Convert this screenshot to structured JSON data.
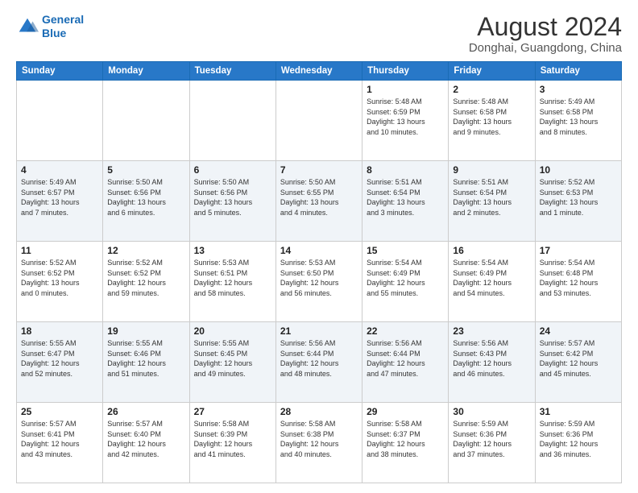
{
  "header": {
    "logo_line1": "General",
    "logo_line2": "Blue",
    "title": "August 2024",
    "subtitle": "Donghai, Guangdong, China"
  },
  "days_of_week": [
    "Sunday",
    "Monday",
    "Tuesday",
    "Wednesday",
    "Thursday",
    "Friday",
    "Saturday"
  ],
  "weeks": [
    [
      {
        "num": "",
        "info": ""
      },
      {
        "num": "",
        "info": ""
      },
      {
        "num": "",
        "info": ""
      },
      {
        "num": "",
        "info": ""
      },
      {
        "num": "1",
        "info": "Sunrise: 5:48 AM\nSunset: 6:59 PM\nDaylight: 13 hours\nand 10 minutes."
      },
      {
        "num": "2",
        "info": "Sunrise: 5:48 AM\nSunset: 6:58 PM\nDaylight: 13 hours\nand 9 minutes."
      },
      {
        "num": "3",
        "info": "Sunrise: 5:49 AM\nSunset: 6:58 PM\nDaylight: 13 hours\nand 8 minutes."
      }
    ],
    [
      {
        "num": "4",
        "info": "Sunrise: 5:49 AM\nSunset: 6:57 PM\nDaylight: 13 hours\nand 7 minutes."
      },
      {
        "num": "5",
        "info": "Sunrise: 5:50 AM\nSunset: 6:56 PM\nDaylight: 13 hours\nand 6 minutes."
      },
      {
        "num": "6",
        "info": "Sunrise: 5:50 AM\nSunset: 6:56 PM\nDaylight: 13 hours\nand 5 minutes."
      },
      {
        "num": "7",
        "info": "Sunrise: 5:50 AM\nSunset: 6:55 PM\nDaylight: 13 hours\nand 4 minutes."
      },
      {
        "num": "8",
        "info": "Sunrise: 5:51 AM\nSunset: 6:54 PM\nDaylight: 13 hours\nand 3 minutes."
      },
      {
        "num": "9",
        "info": "Sunrise: 5:51 AM\nSunset: 6:54 PM\nDaylight: 13 hours\nand 2 minutes."
      },
      {
        "num": "10",
        "info": "Sunrise: 5:52 AM\nSunset: 6:53 PM\nDaylight: 13 hours\nand 1 minute."
      }
    ],
    [
      {
        "num": "11",
        "info": "Sunrise: 5:52 AM\nSunset: 6:52 PM\nDaylight: 13 hours\nand 0 minutes."
      },
      {
        "num": "12",
        "info": "Sunrise: 5:52 AM\nSunset: 6:52 PM\nDaylight: 12 hours\nand 59 minutes."
      },
      {
        "num": "13",
        "info": "Sunrise: 5:53 AM\nSunset: 6:51 PM\nDaylight: 12 hours\nand 58 minutes."
      },
      {
        "num": "14",
        "info": "Sunrise: 5:53 AM\nSunset: 6:50 PM\nDaylight: 12 hours\nand 56 minutes."
      },
      {
        "num": "15",
        "info": "Sunrise: 5:54 AM\nSunset: 6:49 PM\nDaylight: 12 hours\nand 55 minutes."
      },
      {
        "num": "16",
        "info": "Sunrise: 5:54 AM\nSunset: 6:49 PM\nDaylight: 12 hours\nand 54 minutes."
      },
      {
        "num": "17",
        "info": "Sunrise: 5:54 AM\nSunset: 6:48 PM\nDaylight: 12 hours\nand 53 minutes."
      }
    ],
    [
      {
        "num": "18",
        "info": "Sunrise: 5:55 AM\nSunset: 6:47 PM\nDaylight: 12 hours\nand 52 minutes."
      },
      {
        "num": "19",
        "info": "Sunrise: 5:55 AM\nSunset: 6:46 PM\nDaylight: 12 hours\nand 51 minutes."
      },
      {
        "num": "20",
        "info": "Sunrise: 5:55 AM\nSunset: 6:45 PM\nDaylight: 12 hours\nand 49 minutes."
      },
      {
        "num": "21",
        "info": "Sunrise: 5:56 AM\nSunset: 6:44 PM\nDaylight: 12 hours\nand 48 minutes."
      },
      {
        "num": "22",
        "info": "Sunrise: 5:56 AM\nSunset: 6:44 PM\nDaylight: 12 hours\nand 47 minutes."
      },
      {
        "num": "23",
        "info": "Sunrise: 5:56 AM\nSunset: 6:43 PM\nDaylight: 12 hours\nand 46 minutes."
      },
      {
        "num": "24",
        "info": "Sunrise: 5:57 AM\nSunset: 6:42 PM\nDaylight: 12 hours\nand 45 minutes."
      }
    ],
    [
      {
        "num": "25",
        "info": "Sunrise: 5:57 AM\nSunset: 6:41 PM\nDaylight: 12 hours\nand 43 minutes."
      },
      {
        "num": "26",
        "info": "Sunrise: 5:57 AM\nSunset: 6:40 PM\nDaylight: 12 hours\nand 42 minutes."
      },
      {
        "num": "27",
        "info": "Sunrise: 5:58 AM\nSunset: 6:39 PM\nDaylight: 12 hours\nand 41 minutes."
      },
      {
        "num": "28",
        "info": "Sunrise: 5:58 AM\nSunset: 6:38 PM\nDaylight: 12 hours\nand 40 minutes."
      },
      {
        "num": "29",
        "info": "Sunrise: 5:58 AM\nSunset: 6:37 PM\nDaylight: 12 hours\nand 38 minutes."
      },
      {
        "num": "30",
        "info": "Sunrise: 5:59 AM\nSunset: 6:36 PM\nDaylight: 12 hours\nand 37 minutes."
      },
      {
        "num": "31",
        "info": "Sunrise: 5:59 AM\nSunset: 6:36 PM\nDaylight: 12 hours\nand 36 minutes."
      }
    ]
  ]
}
